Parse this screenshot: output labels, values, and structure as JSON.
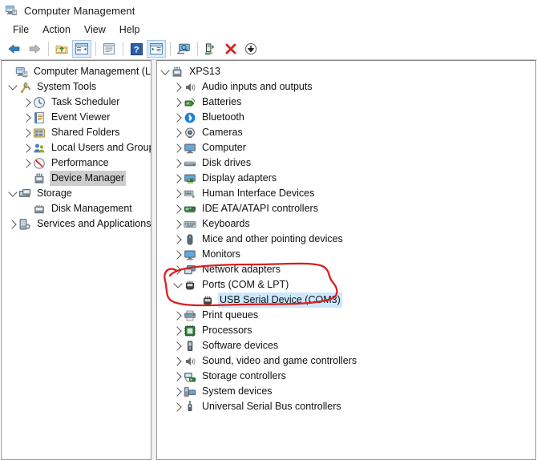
{
  "window": {
    "title": "Computer Management",
    "icon": "computer-management-icon"
  },
  "menubar": {
    "items": [
      {
        "label": "File",
        "name": "menu-file"
      },
      {
        "label": "Action",
        "name": "menu-action"
      },
      {
        "label": "View",
        "name": "menu-view"
      },
      {
        "label": "Help",
        "name": "menu-help"
      }
    ]
  },
  "toolbar": {
    "buttons": [
      {
        "name": "back-button",
        "icon": "back-arrow-icon",
        "tooltip": "Back"
      },
      {
        "name": "forward-button",
        "icon": "forward-arrow-icon",
        "tooltip": "Forward"
      },
      {
        "name": "up-folder-button",
        "icon": "up-folder-icon",
        "tooltip": "Up one level"
      },
      {
        "name": "show-hide-console-tree-button",
        "icon": "console-tree-icon",
        "tooltip": "Show/Hide Console Tree"
      },
      {
        "name": "properties-button",
        "icon": "properties-icon",
        "tooltip": "Properties"
      },
      {
        "name": "help-button",
        "icon": "help-icon",
        "tooltip": "Help"
      },
      {
        "name": "show-hide-action-pane-button",
        "icon": "action-pane-icon",
        "tooltip": "Show/Hide Action Pane"
      },
      {
        "name": "view-button",
        "icon": "monitor-view-icon",
        "tooltip": "View"
      },
      {
        "name": "scan-for-hardware-changes-button",
        "icon": "scan-hardware-icon",
        "tooltip": "Scan for hardware changes"
      },
      {
        "name": "uninstall-device-button",
        "icon": "red-x-icon",
        "tooltip": "Uninstall device"
      },
      {
        "name": "update-driver-button",
        "icon": "download-arrow-icon",
        "tooltip": "Update driver"
      }
    ]
  },
  "console_tree": {
    "root": {
      "label": "Computer Management (Local",
      "icon": "computer-management-icon",
      "expanded": true
    },
    "items": [
      {
        "label": "System Tools",
        "icon": "system-tools-icon",
        "indent": 1,
        "twisty": "down"
      },
      {
        "label": "Task Scheduler",
        "icon": "task-scheduler-icon",
        "indent": 2,
        "twisty": "right"
      },
      {
        "label": "Event Viewer",
        "icon": "event-viewer-icon",
        "indent": 2,
        "twisty": "right"
      },
      {
        "label": "Shared Folders",
        "icon": "shared-folders-icon",
        "indent": 2,
        "twisty": "right"
      },
      {
        "label": "Local Users and Groups",
        "icon": "local-users-icon",
        "indent": 2,
        "twisty": "right"
      },
      {
        "label": "Performance",
        "icon": "performance-icon",
        "indent": 2,
        "twisty": "right"
      },
      {
        "label": "Device Manager",
        "icon": "device-manager-icon",
        "indent": 2,
        "twisty": "none",
        "selected": "gray"
      },
      {
        "label": "Storage",
        "icon": "storage-icon",
        "indent": 1,
        "twisty": "down"
      },
      {
        "label": "Disk Management",
        "icon": "disk-management-icon",
        "indent": 2,
        "twisty": "none"
      },
      {
        "label": "Services and Applications",
        "icon": "services-applications-icon",
        "indent": 1,
        "twisty": "right"
      }
    ]
  },
  "device_tree": {
    "root": {
      "label": "XPS13",
      "icon": "computer-node-icon",
      "twisty": "down",
      "indent": 0
    },
    "items": [
      {
        "label": "Audio inputs and outputs",
        "icon": "speaker-icon",
        "indent": 1,
        "twisty": "right"
      },
      {
        "label": "Batteries",
        "icon": "battery-icon",
        "indent": 1,
        "twisty": "right"
      },
      {
        "label": "Bluetooth",
        "icon": "bluetooth-icon",
        "indent": 1,
        "twisty": "right"
      },
      {
        "label": "Cameras",
        "icon": "camera-icon",
        "indent": 1,
        "twisty": "right"
      },
      {
        "label": "Computer",
        "icon": "monitor-icon",
        "indent": 1,
        "twisty": "right"
      },
      {
        "label": "Disk drives",
        "icon": "disk-drive-icon",
        "indent": 1,
        "twisty": "right"
      },
      {
        "label": "Display adapters",
        "icon": "display-adapter-icon",
        "indent": 1,
        "twisty": "right"
      },
      {
        "label": "Human Interface Devices",
        "icon": "hid-icon",
        "indent": 1,
        "twisty": "right"
      },
      {
        "label": "IDE ATA/ATAPI controllers",
        "icon": "ide-controller-icon",
        "indent": 1,
        "twisty": "right"
      },
      {
        "label": "Keyboards",
        "icon": "keyboard-icon",
        "indent": 1,
        "twisty": "right"
      },
      {
        "label": "Mice and other pointing devices",
        "icon": "mouse-icon",
        "indent": 1,
        "twisty": "right"
      },
      {
        "label": "Monitors",
        "icon": "monitor-icon",
        "indent": 1,
        "twisty": "right"
      },
      {
        "label": "Network adapters",
        "icon": "network-adapter-icon",
        "indent": 1,
        "twisty": "right"
      },
      {
        "label": "Ports (COM & LPT)",
        "icon": "port-icon",
        "indent": 1,
        "twisty": "down"
      },
      {
        "label": "USB Serial Device (COM3)",
        "icon": "port-icon",
        "indent": 2,
        "twisty": "none",
        "selected": "blue"
      },
      {
        "label": "Print queues",
        "icon": "printer-icon",
        "indent": 1,
        "twisty": "right"
      },
      {
        "label": "Processors",
        "icon": "processor-icon",
        "indent": 1,
        "twisty": "right"
      },
      {
        "label": "Software devices",
        "icon": "software-device-icon",
        "indent": 1,
        "twisty": "right"
      },
      {
        "label": "Sound, video and game controllers",
        "icon": "speaker-icon",
        "indent": 1,
        "twisty": "right"
      },
      {
        "label": "Storage controllers",
        "icon": "storage-controller-icon",
        "indent": 1,
        "twisty": "right"
      },
      {
        "label": "System devices",
        "icon": "system-device-icon",
        "indent": 1,
        "twisty": "right"
      },
      {
        "label": "Universal Serial Bus controllers",
        "icon": "usb-icon",
        "indent": 1,
        "twisty": "right"
      }
    ]
  },
  "annotation": {
    "name": "red-ellipse-highlight",
    "color": "#d81f1f",
    "targets": [
      "Ports (COM & LPT)",
      "USB Serial Device (COM3)"
    ]
  },
  "colors": {
    "selection_blue": "#cce8ff",
    "selection_gray": "#cdcdcd",
    "annotation_red": "#d81f1f",
    "toolbar_frame": "#dcecfb"
  }
}
